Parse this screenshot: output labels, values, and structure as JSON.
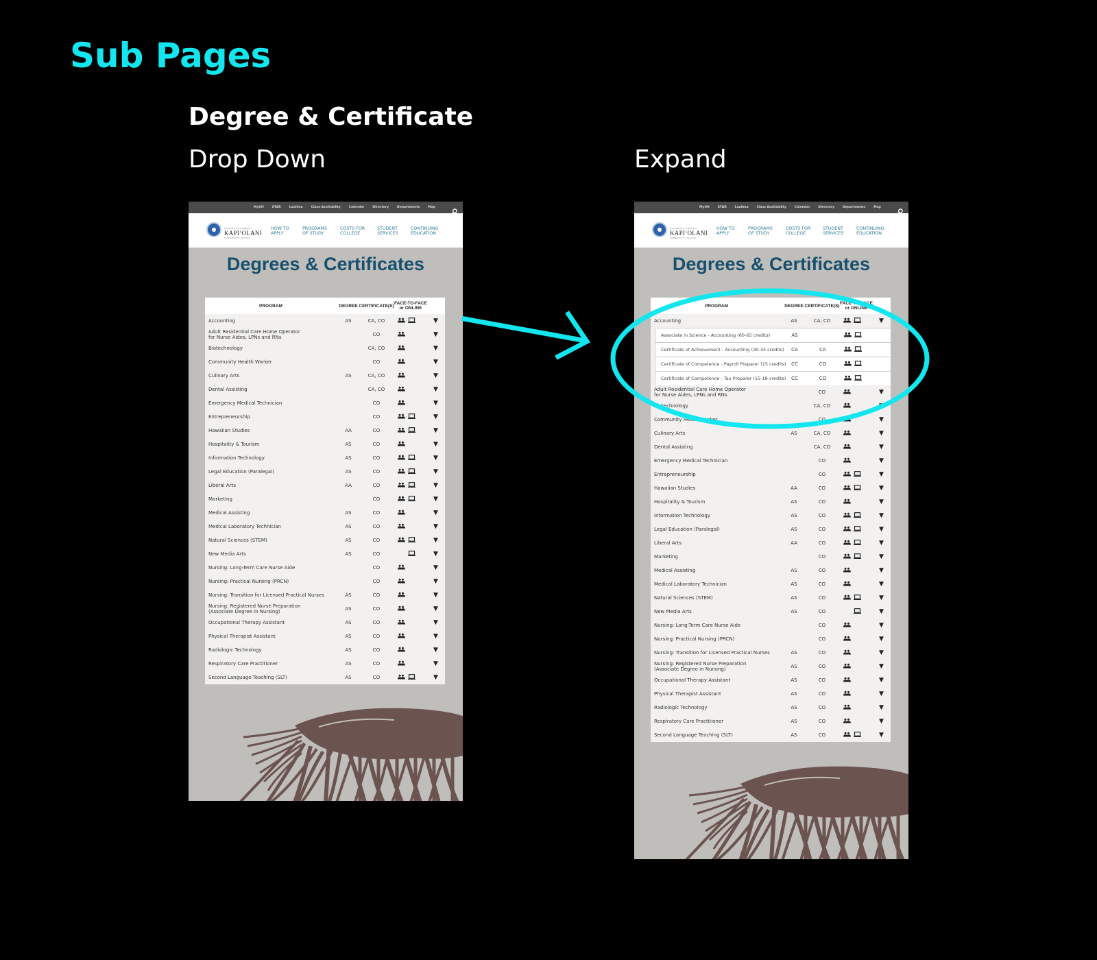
{
  "page": {
    "title": "Sub Pages",
    "section": "Degree & Certificate",
    "variants": [
      "Drop Down",
      "Expand"
    ]
  },
  "colors": {
    "accent": "#13e6ee",
    "title": "#17506d",
    "nav": "#2a7a95",
    "volcano": "#6b5450"
  },
  "site": {
    "top_links": [
      "MyUH",
      "STAR",
      "Laulima",
      "Class Availability",
      "Calendar",
      "Directory",
      "Departments",
      "Map"
    ],
    "search_icon": "search-icon",
    "logo_small": "UNIVERSITY of HAWAIʻI",
    "logo_name": "KAPIʻOLANI",
    "logo_sub": "COMMUNITY COLLEGE",
    "nav": [
      "HOW TO\nAPPLY",
      "PROGRAMS\nOF STUDY",
      "COSTS FOR\nCOLLEGE",
      "STUDENT\nSERVICES",
      "CONTINUING\nEDUCATION"
    ],
    "page_title": "Degrees & Certificates"
  },
  "table": {
    "headers": {
      "program": "PROGRAM",
      "degree": "DEGREE",
      "certificates": "CERTIFICATE(S)",
      "mode": "FACE-TO-FACE\nor ONLINE"
    },
    "rows": [
      {
        "program": "Accounting",
        "degree": "AS",
        "certs": "CA, CO",
        "f2f": true,
        "online": true
      },
      {
        "program": "Adult Residential Care Home Operator\nfor Nurse Aides, LPNs and RNs",
        "degree": "",
        "certs": "CO",
        "f2f": true,
        "online": false
      },
      {
        "program": "Biotechnology",
        "degree": "",
        "certs": "CA, CO",
        "f2f": true,
        "online": false
      },
      {
        "program": "Community Health Worker",
        "degree": "",
        "certs": "CO",
        "f2f": true,
        "online": false
      },
      {
        "program": "Culinary Arts",
        "degree": "AS",
        "certs": "CA, CO",
        "f2f": true,
        "online": false
      },
      {
        "program": "Dental Assisting",
        "degree": "",
        "certs": "CA, CO",
        "f2f": true,
        "online": false
      },
      {
        "program": "Emergency Medical Technician",
        "degree": "",
        "certs": "CO",
        "f2f": true,
        "online": false
      },
      {
        "program": "Entrepreneurship",
        "degree": "",
        "certs": "CO",
        "f2f": true,
        "online": true
      },
      {
        "program": "Hawaiian Studies",
        "degree": "AA",
        "certs": "CO",
        "f2f": true,
        "online": true
      },
      {
        "program": "Hospitality & Tourism",
        "degree": "AS",
        "certs": "CO",
        "f2f": true,
        "online": false
      },
      {
        "program": "Information Technology",
        "degree": "AS",
        "certs": "CO",
        "f2f": true,
        "online": true
      },
      {
        "program": "Legal Education (Paralegal)",
        "degree": "AS",
        "certs": "CO",
        "f2f": true,
        "online": true
      },
      {
        "program": "Liberal Arts",
        "degree": "AA",
        "certs": "CO",
        "f2f": true,
        "online": true
      },
      {
        "program": "Marketing",
        "degree": "",
        "certs": "CO",
        "f2f": true,
        "online": true
      },
      {
        "program": "Medical Assisting",
        "degree": "AS",
        "certs": "CO",
        "f2f": true,
        "online": false
      },
      {
        "program": "Medical Laboratory Technician",
        "degree": "AS",
        "certs": "CO",
        "f2f": true,
        "online": false
      },
      {
        "program": "Natural Sciences (STEM)",
        "degree": "AS",
        "certs": "CO",
        "f2f": true,
        "online": true
      },
      {
        "program": "New Media Arts",
        "degree": "AS",
        "certs": "CO",
        "f2f": false,
        "online": true
      },
      {
        "program": "Nursing: Long-Term Care Nurse Aide",
        "degree": "",
        "certs": "CO",
        "f2f": true,
        "online": false
      },
      {
        "program": "Nursing: Practical Nursing (PRCN)",
        "degree": "",
        "certs": "CO",
        "f2f": true,
        "online": false
      },
      {
        "program": "Nursing: Transition for Licensed Practical Nurses",
        "degree": "AS",
        "certs": "CO",
        "f2f": true,
        "online": false
      },
      {
        "program": "Nursing: Registered Nurse Preparation\n(Associate Degree in Nursing)",
        "degree": "AS",
        "certs": "CO",
        "f2f": true,
        "online": false
      },
      {
        "program": "Occupational Therapy Assistant",
        "degree": "AS",
        "certs": "CO",
        "f2f": true,
        "online": false
      },
      {
        "program": "Physical Therapist Assistant",
        "degree": "AS",
        "certs": "CO",
        "f2f": true,
        "online": false
      },
      {
        "program": "Radiologic Technology",
        "degree": "AS",
        "certs": "CO",
        "f2f": true,
        "online": false
      },
      {
        "program": "Respiratory Care Practitioner",
        "degree": "AS",
        "certs": "CO",
        "f2f": true,
        "online": false
      },
      {
        "program": "Second Language Teaching (SLT)",
        "degree": "AS",
        "certs": "CO",
        "f2f": true,
        "online": true
      }
    ],
    "expanded_subrows": [
      {
        "program": "Associate in Science - Accounting (60-65 credits)",
        "degree": "AS",
        "certs": "",
        "f2f": true,
        "online": true
      },
      {
        "program": "Certificate of Achievement - Accounting (30-34 credits)",
        "degree": "CA",
        "certs": "CA",
        "f2f": true,
        "online": true
      },
      {
        "program": "Certificate of Competence - Payroll Preparer (15 credits)",
        "degree": "CC",
        "certs": "CO",
        "f2f": true,
        "online": true
      },
      {
        "program": "Certificate of Competence - Tax Preparer (15-18 credits)",
        "degree": "CC",
        "certs": "CO",
        "f2f": true,
        "online": true
      }
    ]
  }
}
